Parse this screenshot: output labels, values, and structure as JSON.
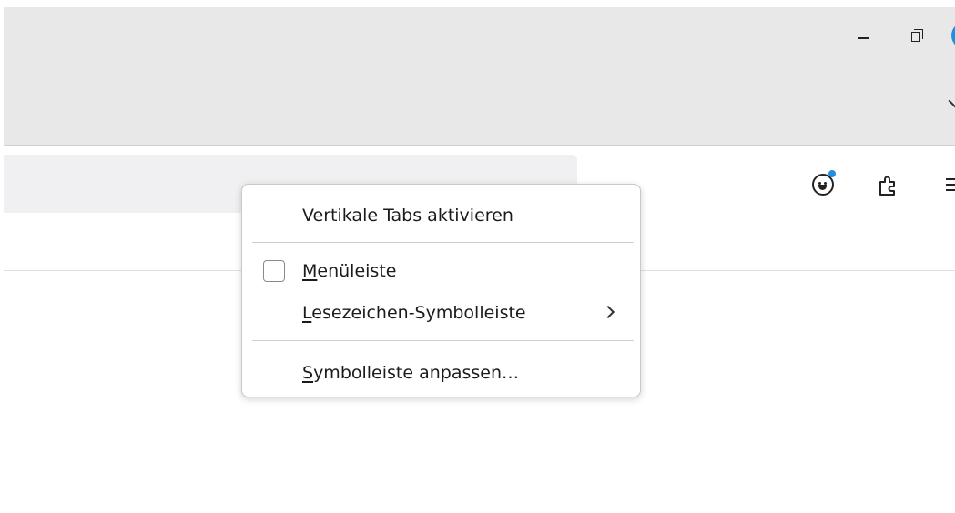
{
  "window": {
    "minimize_icon": "minimize-icon",
    "restore_icon": "restore-icon",
    "list_all_tabs_icon": "chevron-down-icon"
  },
  "toolbar": {
    "account_icon": "account-icon",
    "extensions_icon": "puzzle-icon",
    "menu_icon": "hamburger-menu-icon",
    "accent_color": "#1f8fe0"
  },
  "context_menu": {
    "items": [
      {
        "label": "Vertikale Tabs aktivieren",
        "accesskey": ""
      },
      {
        "label_prefix": "",
        "label_access": "M",
        "label_rest": "enüleiste",
        "checked": false
      },
      {
        "label_prefix": "",
        "label_access": "L",
        "label_rest": "esezeichen-Symbolleiste",
        "has_submenu": true
      },
      {
        "label_prefix": "",
        "label_access": "S",
        "label_rest": "ymbolleiste anpassen…"
      }
    ]
  }
}
